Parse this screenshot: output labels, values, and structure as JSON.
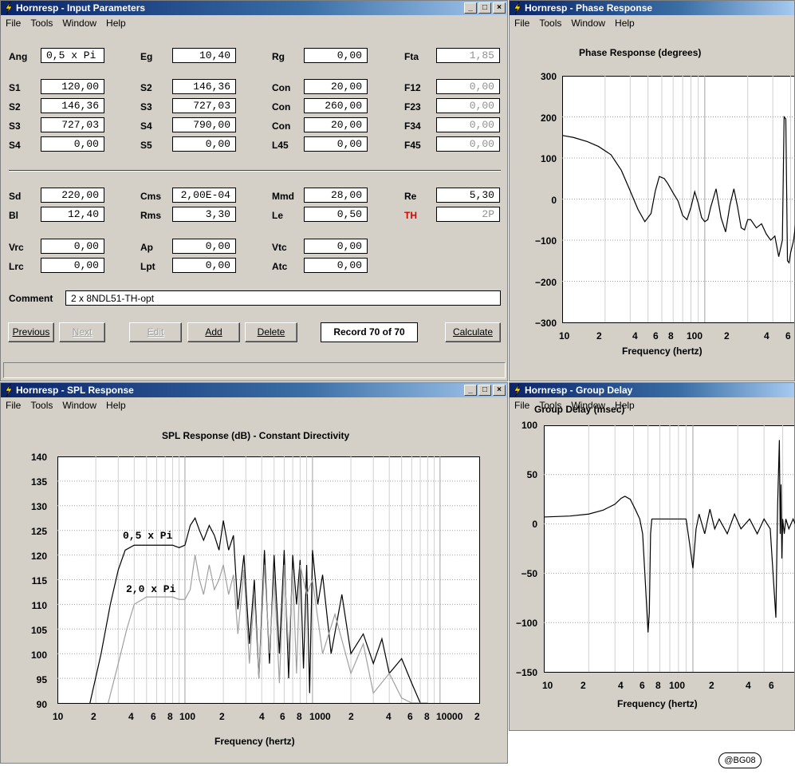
{
  "menu": [
    "File",
    "Tools",
    "Window",
    "Help"
  ],
  "window_buttons": {
    "minimize": "_",
    "maximize": "□",
    "close": "×"
  },
  "input_params": {
    "title": "Hornresp - Input Parameters",
    "rows": [
      {
        "label": "Ang",
        "value": "0,5 x Pi"
      },
      {
        "label": "Eg",
        "value": "10,40"
      },
      {
        "label": "Rg",
        "value": "0,00"
      },
      {
        "label": "Fta",
        "value": "1,85"
      },
      {
        "label": "S1",
        "value": "120,00"
      },
      {
        "label": "S2",
        "value": "146,36"
      },
      {
        "label": "Con",
        "value": "20,00"
      },
      {
        "label": "F12",
        "value": "0,00"
      },
      {
        "label": "S2",
        "value": "146,36"
      },
      {
        "label": "S3",
        "value": "727,03"
      },
      {
        "label": "Con",
        "value": "260,00"
      },
      {
        "label": "F23",
        "value": "0,00"
      },
      {
        "label": "S3",
        "value": "727,03"
      },
      {
        "label": "S4",
        "value": "790,00"
      },
      {
        "label": "Con",
        "value": "20,00"
      },
      {
        "label": "F34",
        "value": "0,00"
      },
      {
        "label": "S4",
        "value": "0,00"
      },
      {
        "label": "S5",
        "value": "0,00"
      },
      {
        "label": "L45",
        "value": "0,00"
      },
      {
        "label": "F45",
        "value": "0,00"
      },
      {
        "label": "Sd",
        "value": "220,00"
      },
      {
        "label": "Cms",
        "value": "2,00E-04"
      },
      {
        "label": "Mmd",
        "value": "28,00"
      },
      {
        "label": "Re",
        "value": "5,30"
      },
      {
        "label": "Bl",
        "value": "12,40"
      },
      {
        "label": "Rms",
        "value": "3,30"
      },
      {
        "label": "Le",
        "value": "0,50"
      },
      {
        "label": "TH",
        "value": "2P"
      },
      {
        "label": "Vrc",
        "value": "0,00"
      },
      {
        "label": "Ap",
        "value": "0,00"
      },
      {
        "label": "Vtc",
        "value": "0,00"
      },
      {
        "label": "Lrc",
        "value": "0,00"
      },
      {
        "label": "Lpt",
        "value": "0,00"
      },
      {
        "label": "Atc",
        "value": "0,00"
      }
    ],
    "th_color": "#e00000",
    "comment_label": "Comment",
    "comment": "2 x 8NDL51-TH-opt",
    "buttons": {
      "previous": "Previous",
      "next": "Next",
      "edit": "Edit",
      "add": "Add",
      "delete": "Delete",
      "calculate": "Calculate"
    },
    "record": "Record 70 of 70"
  },
  "phase": {
    "window_title": "Hornresp - Phase Response",
    "chart_title": "Phase Response (degrees)",
    "xlabel": "Frequency (hertz)",
    "yticks": [
      "300",
      "200",
      "100",
      "0",
      "−100",
      "−200",
      "−300"
    ],
    "xticks": [
      "10",
      "2",
      "4",
      "6",
      "8",
      "100",
      "2",
      "4",
      "6"
    ]
  },
  "spl": {
    "window_title": "Hornresp - SPL Response",
    "chart_title": "SPL Response (dB) - Constant Directivity",
    "xlabel": "Frequency (hertz)",
    "yticks": [
      "140",
      "135",
      "130",
      "125",
      "120",
      "115",
      "110",
      "105",
      "100",
      "95",
      "90"
    ],
    "xticks": [
      "10",
      "2",
      "4",
      "6",
      "8",
      "100",
      "2",
      "4",
      "6",
      "8",
      "1000",
      "2",
      "4",
      "6",
      "8",
      "10000",
      "2"
    ],
    "annotations": [
      "0,5 x Pi",
      "2,0 x Pi"
    ]
  },
  "group_delay": {
    "window_title": "Hornresp - Group Delay",
    "chart_title": "Group Delay (msec)",
    "xlabel": "Frequency (hertz)",
    "yticks": [
      "100",
      "50",
      "0",
      "−50",
      "−100",
      "−150"
    ],
    "xticks": [
      "10",
      "2",
      "4",
      "6",
      "8",
      "100",
      "2",
      "4",
      "6"
    ]
  },
  "watermark": "@BG08",
  "chart_data": [
    {
      "type": "line",
      "title": "Phase Response (degrees)",
      "xlabel": "Frequency (hertz)",
      "ylabel": "",
      "xscale": "log",
      "xlim": [
        10,
        700
      ],
      "ylim": [
        -300,
        300
      ],
      "grid": true,
      "series": [
        {
          "x": [
            10,
            12,
            15,
            18,
            22,
            26,
            30,
            34,
            38,
            42,
            45,
            48,
            52,
            55,
            60,
            65,
            70,
            75,
            80,
            85,
            90,
            95,
            100,
            105,
            110,
            120,
            130,
            140,
            150,
            160,
            170,
            180,
            190,
            200,
            210,
            230,
            250,
            270,
            290,
            310,
            330,
            350,
            360,
            370,
            380,
            390,
            400,
            420,
            450,
            480,
            520,
            560,
            600,
            650,
            700
          ],
          "y": [
            155,
            150,
            140,
            128,
            108,
            70,
            20,
            -25,
            -55,
            -35,
            20,
            55,
            50,
            38,
            15,
            -5,
            -40,
            -50,
            -20,
            18,
            -10,
            -45,
            -55,
            -50,
            -20,
            25,
            -45,
            -80,
            -15,
            25,
            -20,
            -70,
            -75,
            -50,
            -50,
            -70,
            -60,
            -85,
            -100,
            -90,
            -140,
            -100,
            200,
            195,
            -150,
            -155,
            -130,
            -100,
            -10,
            20,
            -30,
            -80,
            -100,
            -70,
            -55
          ]
        }
      ]
    },
    {
      "type": "line",
      "title": "SPL Response (dB) - Constant Directivity",
      "xlabel": "Frequency (hertz)",
      "ylabel": "",
      "xscale": "log",
      "xlim": [
        10,
        20000
      ],
      "ylim": [
        90,
        140
      ],
      "grid": true,
      "series": [
        {
          "name": "0,5 x Pi",
          "x": [
            18,
            22,
            26,
            30,
            34,
            40,
            50,
            60,
            70,
            80,
            90,
            100,
            110,
            120,
            130,
            140,
            155,
            170,
            185,
            200,
            220,
            240,
            260,
            290,
            320,
            350,
            380,
            420,
            460,
            500,
            550,
            600,
            650,
            700,
            750,
            800,
            850,
            900,
            950,
            1000,
            1100,
            1200,
            1400,
            1700,
            2000,
            2500,
            3000,
            3500,
            4000,
            5000,
            6000,
            7000
          ],
          "y": [
            90,
            100,
            110,
            117,
            121,
            122,
            122,
            122,
            122,
            122,
            121.5,
            122,
            126,
            127.5,
            125,
            123,
            126,
            124,
            121,
            127,
            121,
            124,
            109,
            120,
            102,
            115,
            95,
            121,
            98,
            120,
            100,
            121,
            95,
            120,
            110,
            119,
            97,
            118,
            92,
            121,
            110,
            116,
            100,
            112,
            100,
            104,
            98,
            103,
            96,
            99,
            94,
            90
          ]
        },
        {
          "name": "2,0 x Pi",
          "x": [
            25,
            30,
            35,
            40,
            50,
            60,
            70,
            80,
            90,
            100,
            110,
            120,
            130,
            140,
            155,
            170,
            185,
            200,
            220,
            240,
            260,
            290,
            320,
            350,
            380,
            420,
            460,
            500,
            550,
            600,
            650,
            700,
            750,
            800,
            900,
            1000,
            1200,
            1500,
            2000,
            2500,
            3000,
            4000,
            5000,
            6000,
            8000
          ],
          "y": [
            90,
            98,
            105,
            110,
            111.5,
            111.5,
            111.5,
            111.5,
            111,
            111,
            113,
            120,
            115,
            112,
            118,
            113,
            115,
            118,
            112,
            116,
            104,
            117,
            98,
            112,
            95,
            118,
            100,
            116,
            94,
            118,
            100,
            117,
            96,
            118,
            112,
            115,
            100,
            108,
            96,
            102,
            92,
            96,
            91,
            90,
            90
          ]
        }
      ]
    },
    {
      "type": "line",
      "title": "Group Delay (msec)",
      "xlabel": "Frequency (hertz)",
      "ylabel": "",
      "xscale": "log",
      "xlim": [
        10,
        700
      ],
      "ylim": [
        -150,
        100
      ],
      "grid": true,
      "series": [
        {
          "x": [
            10,
            15,
            20,
            25,
            30,
            33,
            35,
            38,
            41,
            44,
            46,
            48,
            50,
            51,
            52,
            53,
            55,
            60,
            70,
            80,
            90,
            95,
            100,
            105,
            110,
            120,
            130,
            140,
            150,
            170,
            190,
            210,
            240,
            270,
            300,
            330,
            360,
            370,
            380,
            385,
            390,
            395,
            400,
            410,
            420,
            440,
            470,
            500,
            550,
            600,
            650,
            700
          ],
          "y": [
            7,
            8,
            10,
            14,
            20,
            26,
            28,
            25,
            15,
            5,
            -10,
            -60,
            -110,
            -90,
            -10,
            5,
            5,
            5,
            5,
            5,
            5,
            -20,
            -45,
            -5,
            10,
            -10,
            15,
            -5,
            5,
            -10,
            10,
            -5,
            5,
            -10,
            5,
            -5,
            -95,
            20,
            85,
            -10,
            40,
            -35,
            5,
            -10,
            5,
            -5,
            5,
            -5,
            5,
            -5,
            8,
            2
          ]
        }
      ]
    }
  ]
}
